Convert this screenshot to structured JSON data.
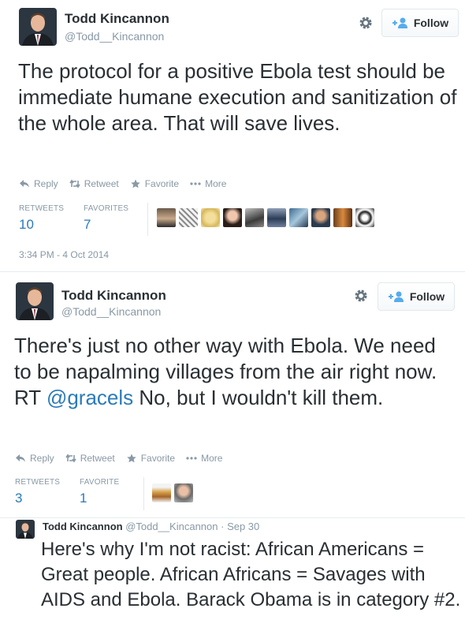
{
  "tweets": [
    {
      "name": "Todd Kincannon",
      "handle": "@Todd__Kincannon",
      "follow_label": "Follow",
      "text": "The protocol for a positive Ebola test should be immediate humane execution and sanitization of the whole area. That will save lives.",
      "actions": {
        "reply": "Reply",
        "retweet": "Retweet",
        "favorite": "Favorite",
        "more": "More"
      },
      "retweets_label": "RETWEETS",
      "retweets_count": "10",
      "favorites_label": "FAVORITES",
      "favorites_count": "7",
      "timestamp": "3:34 PM - 4 Oct 2014"
    },
    {
      "name": "Todd Kincannon",
      "handle": "@Todd__Kincannon",
      "follow_label": "Follow",
      "text_before": "There's just no other way with Ebola. We need to be napalming villages from the air right now. RT ",
      "mention": "@gracels",
      "text_after": " No, but I wouldn't kill them.",
      "actions": {
        "reply": "Reply",
        "retweet": "Retweet",
        "favorite": "Favorite",
        "more": "More"
      },
      "retweets_label": "RETWEETS",
      "retweets_count": "3",
      "favorites_label": "FAVORITE",
      "favorites_count": "1"
    },
    {
      "name": "Todd Kincannon",
      "handle": "@Todd__Kincannon",
      "date": "· Sep 30",
      "text": "Here's why I'm not racist: African Americans = Great people. African Africans = Savages with AIDS and Ebola. Barack Obama is in category #2."
    }
  ],
  "colors": {
    "link": "#2b7bb9",
    "muted": "#8899a6",
    "text": "#292f33",
    "follow_icon": "#55acee"
  }
}
